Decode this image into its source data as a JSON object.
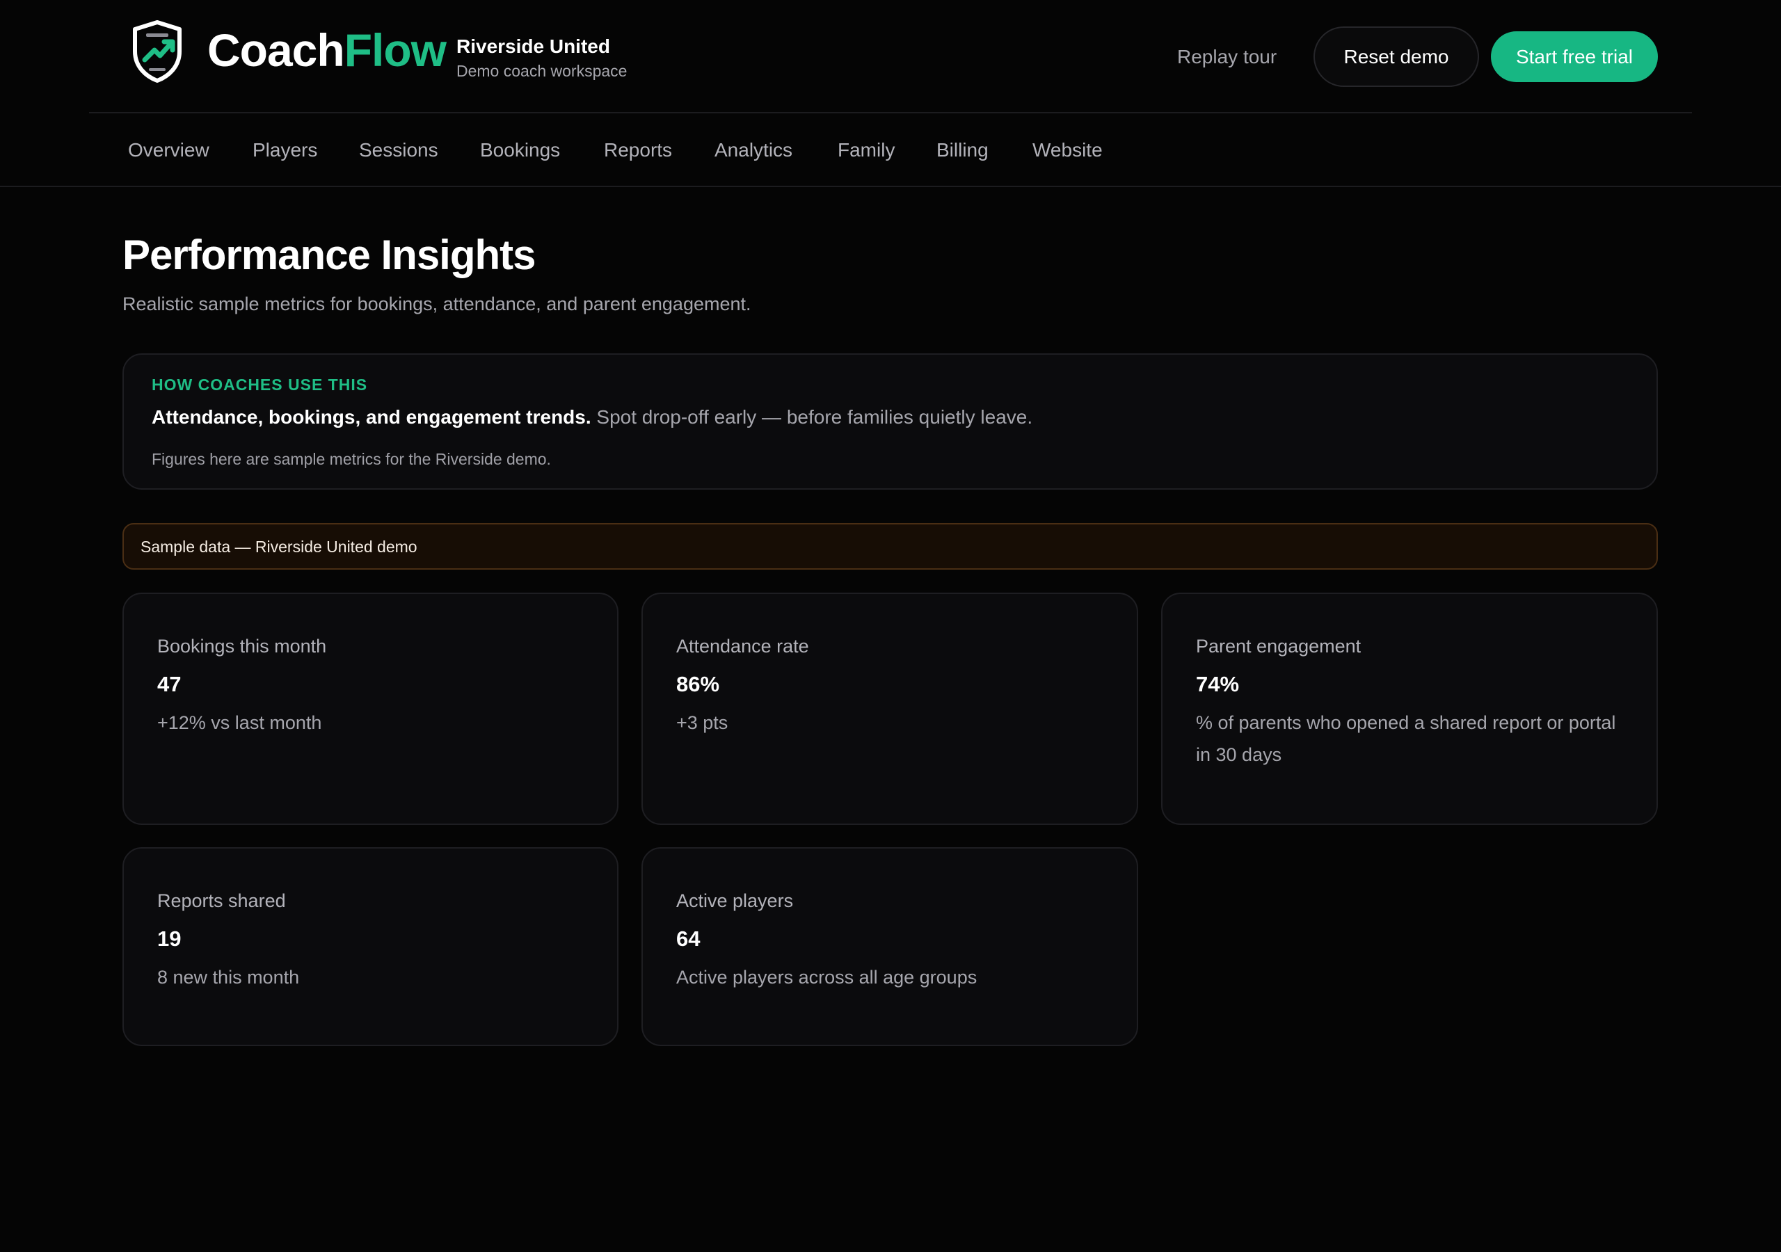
{
  "header": {
    "brand_main": "Coach",
    "brand_accent": "Flow",
    "workspace_name": "Riverside United",
    "workspace_sub": "Demo coach workspace",
    "replay_label": "Replay tour",
    "reset_label": "Reset demo",
    "trial_label": "Start free trial",
    "logo_icon": "shield-trend-icon",
    "accent_color": "#1fbe86"
  },
  "nav": {
    "items": [
      {
        "label": "Overview"
      },
      {
        "label": "Players"
      },
      {
        "label": "Sessions"
      },
      {
        "label": "Bookings"
      },
      {
        "label": "Reports"
      },
      {
        "label": "Analytics"
      },
      {
        "label": "Family"
      },
      {
        "label": "Billing"
      },
      {
        "label": "Website"
      }
    ]
  },
  "page": {
    "title": "Performance Insights",
    "subtitle": "Realistic sample metrics for bookings, attendance, and parent engagement."
  },
  "info": {
    "kicker": "HOW COACHES USE THIS",
    "strong": "Attendance, bookings, and engagement trends.",
    "rest": " Spot drop-off early — before families quietly leave.",
    "note": "Figures here are sample metrics for the Riverside demo."
  },
  "banner": {
    "text": "Sample data — Riverside United demo",
    "border_color": "#4a2e14"
  },
  "metrics": [
    {
      "label": "Bookings this month",
      "value": "47",
      "note": "+12% vs last month"
    },
    {
      "label": "Attendance rate",
      "value": "86%",
      "note": "+3 pts"
    },
    {
      "label": "Parent engagement",
      "value": "74%",
      "note": "% of parents who opened a shared report or portal in 30 days"
    },
    {
      "label": "Reports shared",
      "value": "19",
      "note": "8 new this month"
    },
    {
      "label": "Active players",
      "value": "64",
      "note": "Active players across all age groups"
    }
  ]
}
